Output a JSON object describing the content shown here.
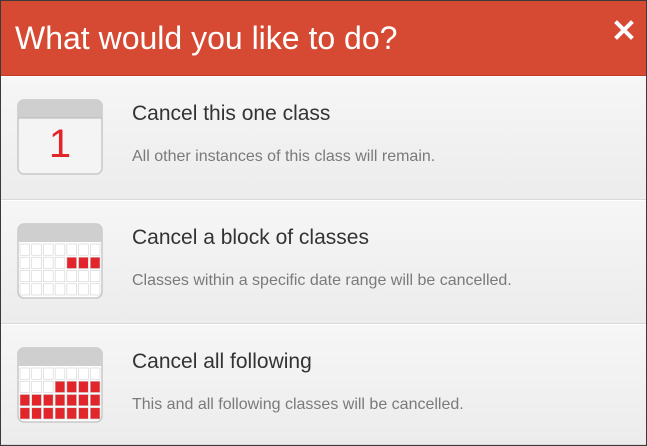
{
  "dialog": {
    "title": "What would you like to do?",
    "close_label": "✕",
    "accent_color": "#d64a33"
  },
  "options": [
    {
      "title": "Cancel this one class",
      "description": "All other instances of this class will remain.",
      "icon": "calendar-single-day-icon",
      "day_number": "1"
    },
    {
      "title": "Cancel a block of classes",
      "description": "Classes within a specific date range will be cancelled.",
      "icon": "calendar-block-icon"
    },
    {
      "title": "Cancel all following",
      "description": "This and all following classes will be cancelled.",
      "icon": "calendar-all-following-icon"
    }
  ]
}
